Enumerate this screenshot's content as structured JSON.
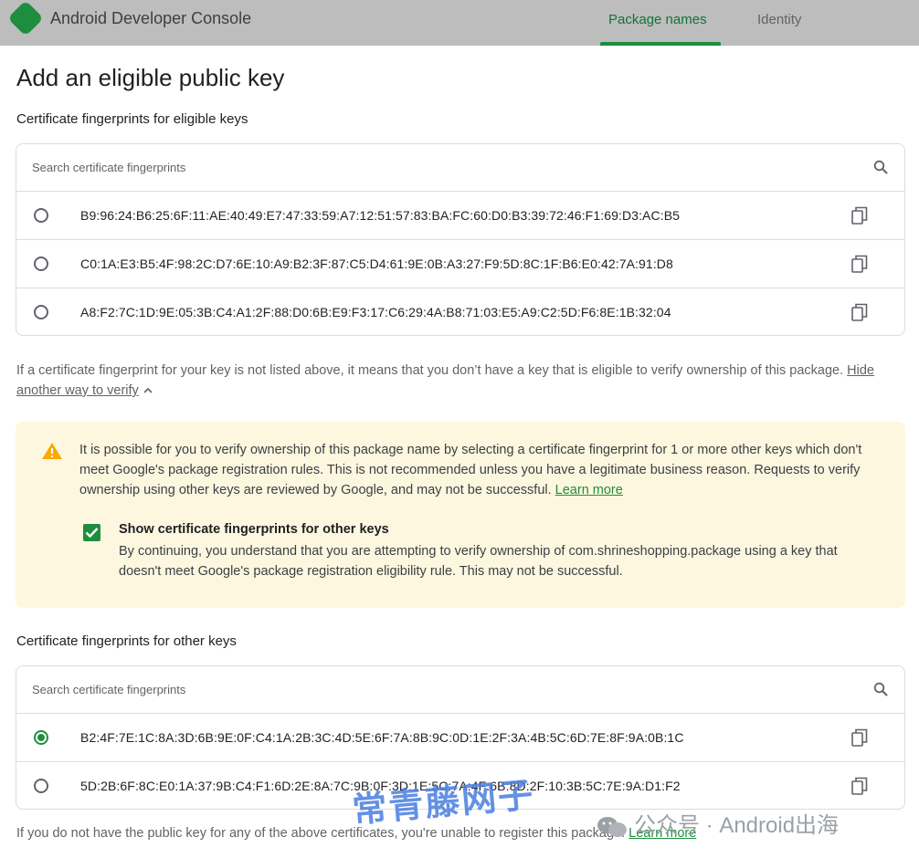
{
  "header": {
    "app_title": "Android Developer Console",
    "tabs": [
      {
        "label": "Package names",
        "active": true
      },
      {
        "label": "Identity",
        "active": false
      }
    ]
  },
  "page_title": "Add an eligible public key",
  "eligible": {
    "title": "Certificate fingerprints for eligible keys",
    "search_placeholder": "Search certificate fingerprints",
    "rows": [
      {
        "fingerprint": "B9:96:24:B6:25:6F:11:AE:40:49:E7:47:33:59:A7:12:51:57:83:BA:FC:60:D0:B3:39:72:46:F1:69:D3:AC:B5",
        "selected": false
      },
      {
        "fingerprint": "C0:1A:E3:B5:4F:98:2C:D7:6E:10:A9:B2:3F:87:C5:D4:61:9E:0B:A3:27:F9:5D:8C:1F:B6:E0:42:7A:91:D8",
        "selected": false
      },
      {
        "fingerprint": "A8:F2:7C:1D:9E:05:3B:C4:A1:2F:88:D0:6B:E9:F3:17:C6:29:4A:B8:71:03:E5:A9:C2:5D:F6:8E:1B:32:04",
        "selected": false
      }
    ]
  },
  "help": {
    "text": "If a certificate fingerprint for your key is not listed above, it means that you don’t have a key that is eligible to verify ownership of this package.",
    "link": "Hide another way to verify"
  },
  "warning": {
    "text": "It is possible for you to verify ownership of this package name by selecting a certificate fingerprint for 1 or more other keys which don't meet Google's package registration  rules. This is not recommended unless you have a legitimate business reason. Requests to verify ownership using other keys are reviewed by Google, and may not be successful.",
    "link": "Learn more",
    "accent": "#f9ab00",
    "checkbox": {
      "checked": true,
      "label": "Show certificate fingerprints for other keys",
      "description": "By continuing, you understand that you are attempting to verify ownership of com.shrineshopping.package using a key that doesn't meet Google's package registration eligibility rule. This may not be successful."
    }
  },
  "other": {
    "title": "Certificate fingerprints for other keys",
    "search_placeholder": "Search certificate fingerprints",
    "rows": [
      {
        "fingerprint": "B2:4F:7E:1C:8A:3D:6B:9E:0F:C4:1A:2B:3C:4D:5E:6F:7A:8B:9C:0D:1E:2F:3A:4B:5C:6D:7E:8F:9A:0B:1C",
        "selected": true
      },
      {
        "fingerprint": "5D:2B:6F:8C:E0:1A:37:9B:C4:F1:6D:2E:8A:7C:9B:0F:3D:1E:5C:7A:4F:6B:8D:2F:10:3B:5C:7E:9A:D1:F2",
        "selected": false
      }
    ]
  },
  "footer": {
    "text": "If you do not have the public key for any of the above certificates, you're unable to register this package.",
    "link": "Learn more"
  },
  "watermark": {
    "left": "常青藤网子",
    "right": "公众号 · Android出海"
  },
  "colors": {
    "brand_green": "#1e8e3e",
    "warning_bg": "#fef7e0",
    "topbar_bg": "#bdbdbd"
  }
}
